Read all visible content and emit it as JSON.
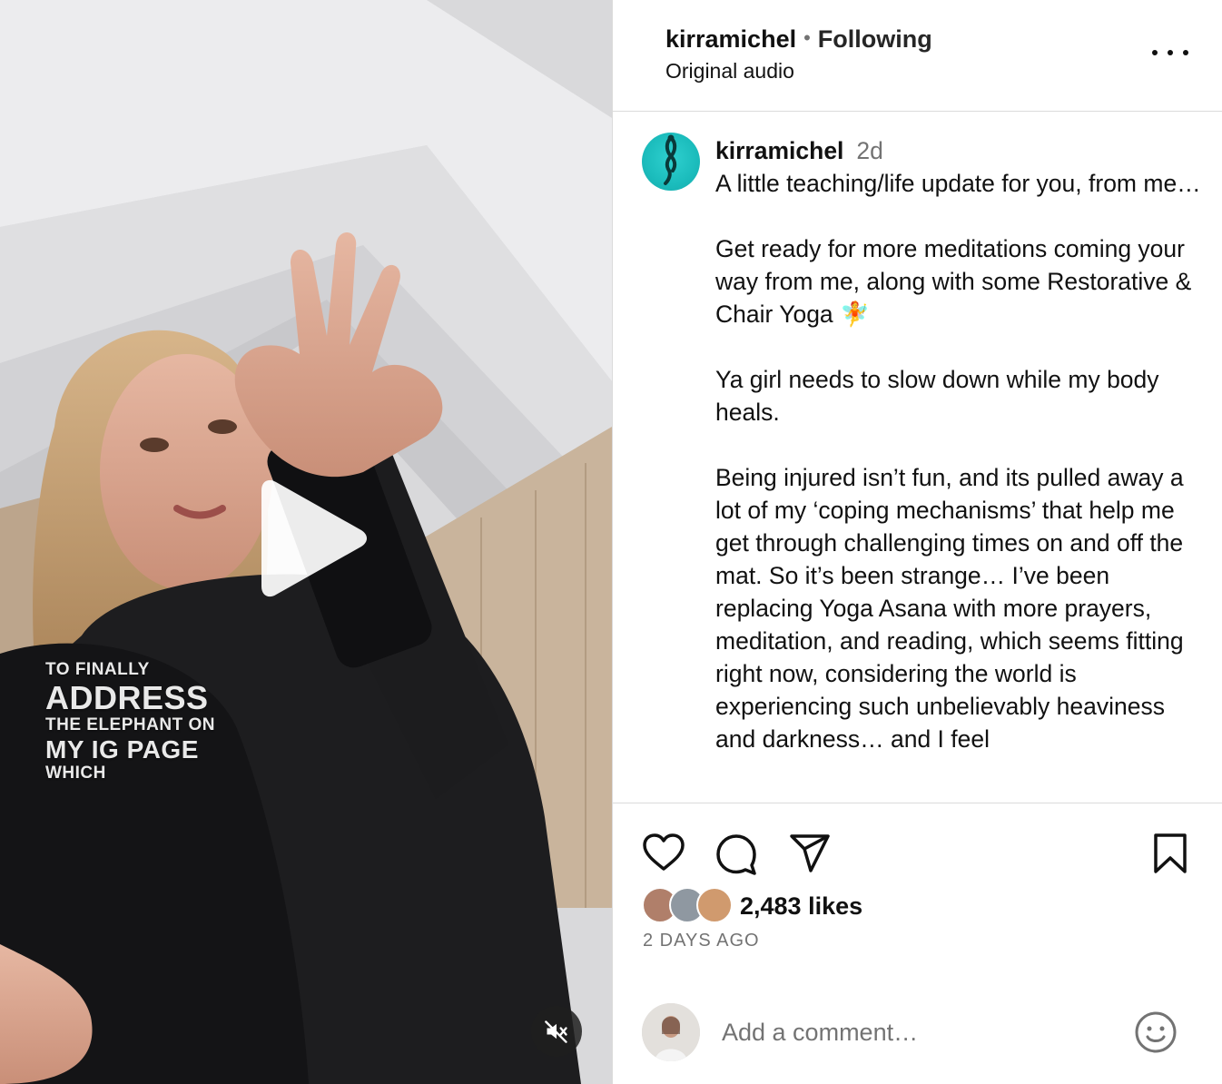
{
  "video": {
    "overlay_line1": "TO FINALLY",
    "overlay_line2": "ADDRESS",
    "overlay_line3": "THE ELEPHANT ON",
    "overlay_line4": "MY IG PAGE",
    "overlay_line5": "WHICH",
    "play_icon": "play-icon",
    "mute_icon": "speaker-muted-icon"
  },
  "header": {
    "username": "kirramichel",
    "separator": "•",
    "follow_status": "Following",
    "audio": "Original audio",
    "more_icon": "ellipsis-icon"
  },
  "post": {
    "author": "kirramichel",
    "time": "2d",
    "paragraphs": [
      "A little teaching/life update for you, from me…",
      "Get ready for more meditations coming your way from me, along with some Restorative & Chair Yoga 🧚",
      "Ya girl needs to slow down while my body heals.",
      "Being injured isn’t fun, and its pulled away a lot of my ‘coping mechanisms’ that help me get through challenging times on and off the mat. So it’s been strange… I’ve been replacing Yoga Asana with more prayers, meditation, and reading, which seems fitting right now, considering the world is experiencing such unbelievably heaviness and darkness… and I feel"
    ]
  },
  "actions": {
    "like_icon": "heart-icon",
    "comment_icon": "comment-icon",
    "share_icon": "paper-plane-icon",
    "save_icon": "bookmark-icon",
    "likes": "2,483 likes",
    "posted": "2 days ago"
  },
  "comment": {
    "placeholder": "Add a comment…",
    "emoji_icon": "smiley-icon"
  }
}
